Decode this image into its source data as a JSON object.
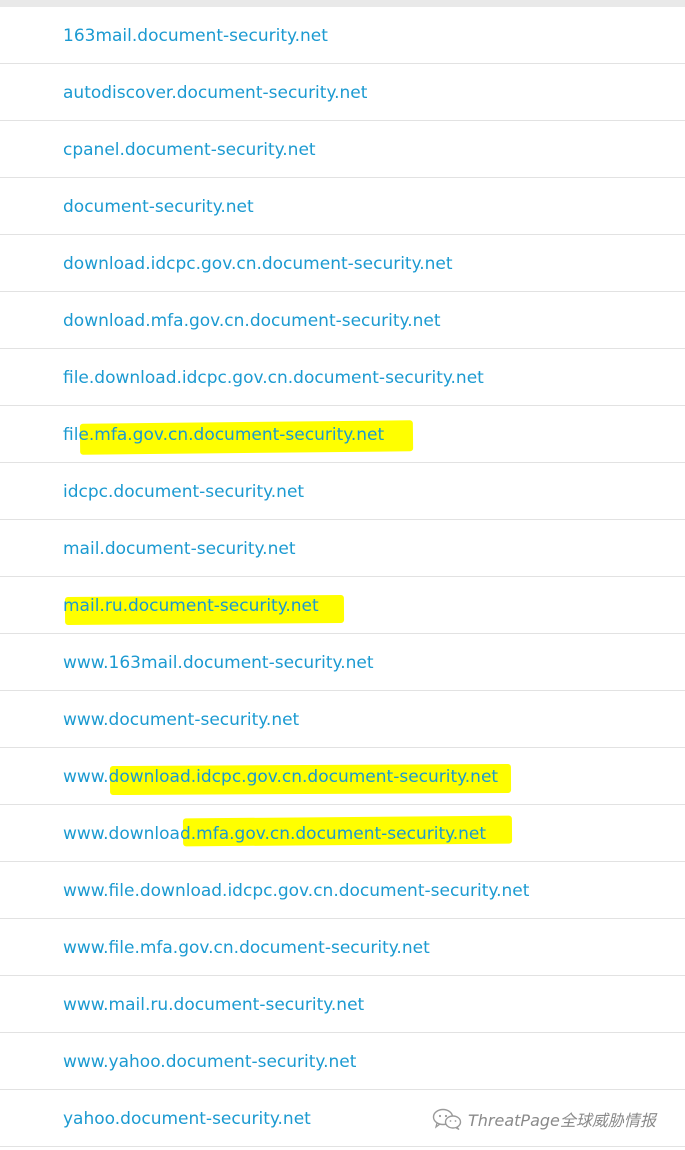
{
  "domains": [
    "163mail.document-security.net",
    "autodiscover.document-security.net",
    "cpanel.document-security.net",
    "document-security.net",
    "download.idcpc.gov.cn.document-security.net",
    "download.mfa.gov.cn.document-security.net",
    "file.download.idcpc.gov.cn.document-security.net",
    "file.mfa.gov.cn.document-security.net",
    "idcpc.document-security.net",
    "mail.document-security.net",
    "mail.ru.document-security.net",
    "www.163mail.document-security.net",
    "www.document-security.net",
    "www.download.idcpc.gov.cn.document-security.net",
    "www.download.mfa.gov.cn.document-security.net",
    "www.file.download.idcpc.gov.cn.document-security.net",
    "www.file.mfa.gov.cn.document-security.net",
    "www.mail.ru.document-security.net",
    "www.yahoo.document-security.net",
    "yahoo.document-security.net"
  ],
  "highlighted_rows": [
    7,
    10,
    13,
    14
  ],
  "colors": {
    "link": "#1b9ad1",
    "highlight": "#ffff00",
    "highlighted_text": "#2d7e3a",
    "divider": "#e2e2e2",
    "watermark": "#8a8a8a"
  },
  "watermark": {
    "icon": "wechat-icon",
    "text": "ThreatPage全球威胁情报"
  }
}
